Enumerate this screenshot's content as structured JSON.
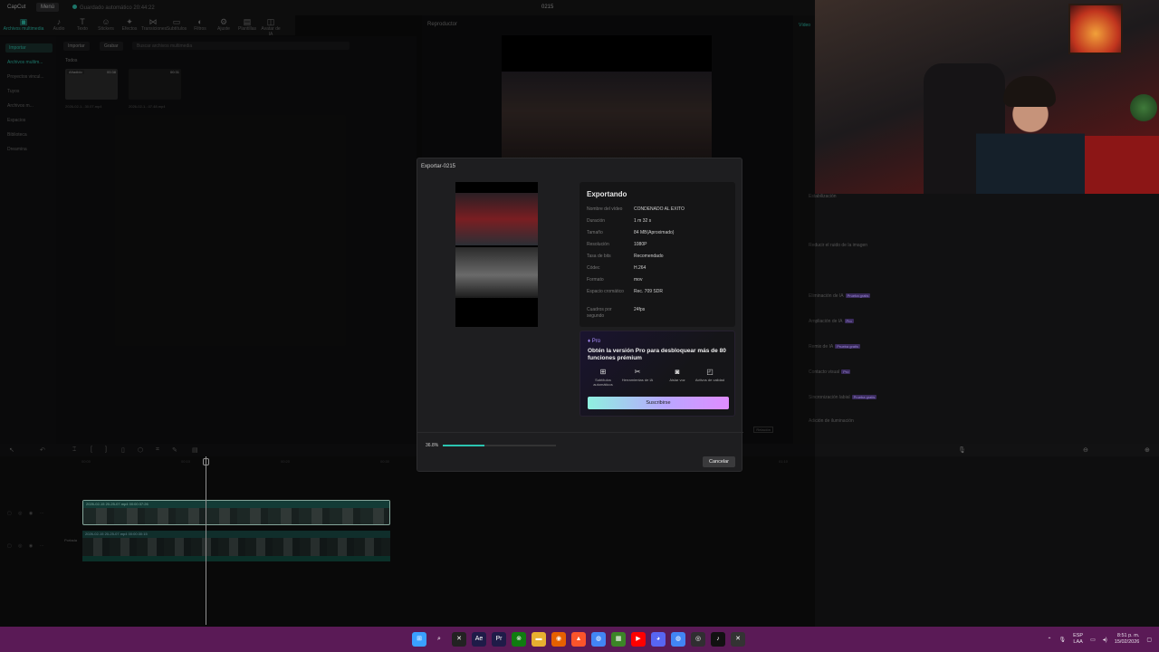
{
  "titlebar": {
    "app_name": "CapCut",
    "menu": "Menú",
    "autosave": "Guardado automático 20:44:22",
    "project": "0215"
  },
  "media_tools": [
    {
      "icon": "media-icon",
      "label": "Archivos multimedia",
      "glyph": "▣"
    },
    {
      "icon": "audio-icon",
      "label": "Audio",
      "glyph": "♪"
    },
    {
      "icon": "text-icon",
      "label": "Texto",
      "glyph": "T"
    },
    {
      "icon": "sticker-icon",
      "label": "Stickers",
      "glyph": "☺"
    },
    {
      "icon": "effects-icon",
      "label": "Efectos",
      "glyph": "✦"
    },
    {
      "icon": "transitions-icon",
      "label": "Transiciones",
      "glyph": "⋈"
    },
    {
      "icon": "subtitles-icon",
      "label": "Subtítulos",
      "glyph": "▭"
    },
    {
      "icon": "filters-icon",
      "label": "Filtros",
      "glyph": "◐"
    },
    {
      "icon": "adjust-icon",
      "label": "Ajuste",
      "glyph": "⚙"
    },
    {
      "icon": "templates-icon",
      "label": "Plantillas",
      "glyph": "▤"
    },
    {
      "icon": "ai-avatar-icon",
      "label": "Avatar de IA",
      "glyph": "◫"
    }
  ],
  "leftnav": {
    "items": [
      "Importar",
      "Archivos multim...",
      "Proyectos vincul...",
      "Tuyos",
      "Archivos m...",
      "Espacios",
      "Biblioteca",
      "Dreamina"
    ]
  },
  "media": {
    "import_label": "Importar",
    "record_label": "Grabar",
    "search_placeholder": "Buscar archivos multimedia",
    "all_label": "Todos",
    "thumbs": [
      {
        "tag": "Añadido",
        "duration": "00:38",
        "name": "2026-02-1...30.07.mp4"
      },
      {
        "tag": "",
        "duration": "00:31",
        "name": "2026-02-1...07.48.mp4"
      }
    ]
  },
  "player": {
    "label": "Reproductor",
    "ratio": "Relación"
  },
  "inspector": {
    "tab": "Vídeo",
    "items": [
      {
        "label": "Estabilización",
        "badge": ""
      },
      {
        "label": "Reducir el ruido de la imagen",
        "badge": ""
      },
      {
        "label": "Eliminación de IA",
        "badge": "Prueba gratis"
      },
      {
        "label": "Ampliación de IA",
        "badge": "Pro"
      },
      {
        "label": "Remix de IA",
        "badge": "Prueba gratis"
      },
      {
        "label": "Contacto visual",
        "badge": "Pro"
      },
      {
        "label": "Sincronización labial",
        "badge": "Prueba gratis"
      },
      {
        "label": "Adición de iluminación",
        "badge": ""
      }
    ]
  },
  "timeline": {
    "ruler": [
      "00:00",
      "00:10",
      "00:20",
      "00:30",
      "00:40",
      "00:50",
      "01:00",
      "01:10"
    ],
    "clip1_label": "2026-02-15 20-25-07.mp4  00:00:37:26",
    "clip2_label": "2026-02-15 20-25-07.mp4  00:00:30:15",
    "cover_label": "Portada"
  },
  "dialog": {
    "title": "Exportar-0215",
    "heading": "Exportando",
    "fields": [
      {
        "k": "Nombre del vídeo",
        "v": "CONDENADO AL EXITO"
      },
      {
        "k": "Duración",
        "v": "1 m 32 s"
      },
      {
        "k": "Tamaño",
        "v": "84 MB(Aproximado)"
      },
      {
        "k": "Resolución",
        "v": "1080P"
      },
      {
        "k": "Tasa de bits",
        "v": "Recomendado"
      },
      {
        "k": "Códec",
        "v": "H.264"
      },
      {
        "k": "Formato",
        "v": "mov"
      },
      {
        "k": "Espacio cromático",
        "v": "Rec. 709 SDR"
      },
      {
        "k": "Cuadros por segundo",
        "v": "24fps"
      }
    ],
    "pro_tag": "Pro",
    "pro_pitch": "Obtén la versión Pro para desbloquear más de 80 funciones prémium",
    "features": [
      {
        "icon": "auto-subtitles-icon",
        "glyph": "⊞",
        "label": "Subtítulos automáticos"
      },
      {
        "icon": "ai-tools-icon",
        "glyph": "✂",
        "label": "Herramientas de IA"
      },
      {
        "icon": "isolate-voice-icon",
        "glyph": "◙",
        "label": "Aislar voz"
      },
      {
        "icon": "quality-icon",
        "glyph": "◰",
        "label": "Activos de calidad"
      }
    ],
    "subscribe": "Suscribirse",
    "progress_text": "36.8%",
    "progress": 0.368,
    "cancel": "Cancelar"
  },
  "taskbar": {
    "apps": [
      {
        "icon": "windows-start-icon",
        "glyph": "⊞",
        "color": "#3aa0ff"
      },
      {
        "icon": "search-icon",
        "glyph": "⌕",
        "color": "#5a1a56"
      },
      {
        "icon": "capcut-icon",
        "glyph": "✕",
        "color": "#222"
      },
      {
        "icon": "after-effects-icon",
        "glyph": "Ae",
        "color": "#1f1b48"
      },
      {
        "icon": "premiere-icon",
        "glyph": "Pr",
        "color": "#1f1b48"
      },
      {
        "icon": "xbox-icon",
        "glyph": "⊗",
        "color": "#107c10"
      },
      {
        "icon": "file-explorer-icon",
        "glyph": "▬",
        "color": "#e8b030"
      },
      {
        "icon": "firefox-icon",
        "glyph": "◉",
        "color": "#e66000"
      },
      {
        "icon": "brave-icon",
        "glyph": "▲",
        "color": "#fb542b"
      },
      {
        "icon": "chrome-icon",
        "glyph": "◍",
        "color": "#4285f4"
      },
      {
        "icon": "minecraft-icon",
        "glyph": "▦",
        "color": "#3c8527"
      },
      {
        "icon": "youtube-icon",
        "glyph": "▶",
        "color": "#ff0000"
      },
      {
        "icon": "discord-icon",
        "glyph": "◕",
        "color": "#5865f2"
      },
      {
        "icon": "chrome-alt-icon",
        "glyph": "◍",
        "color": "#4285f4"
      },
      {
        "icon": "obs-icon",
        "glyph": "◎",
        "color": "#302e31"
      },
      {
        "icon": "tiktok-icon",
        "glyph": "♪",
        "color": "#111"
      },
      {
        "icon": "capcut-active-icon",
        "glyph": "✕",
        "color": "#333"
      }
    ],
    "lang_top": "ESP",
    "lang_bottom": "LAA",
    "time": "8:51 p. m.",
    "date": "15/02/2026"
  }
}
